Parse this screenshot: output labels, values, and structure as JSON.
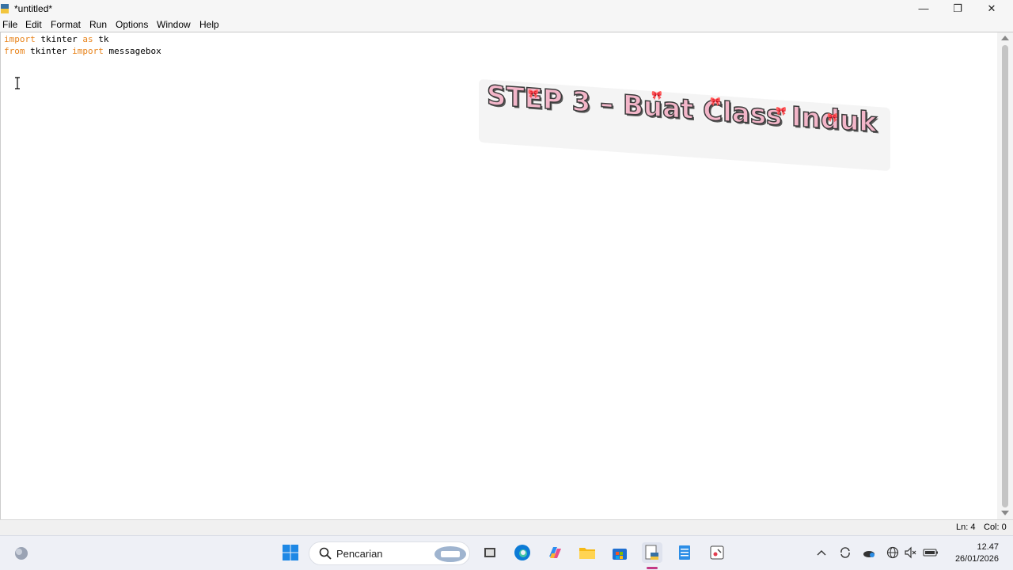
{
  "window": {
    "title": "*untitled*",
    "minimize_glyph": "—",
    "maximize_glyph": "❐",
    "close_glyph": "✕"
  },
  "menu": {
    "items": [
      "File",
      "Edit",
      "Format",
      "Run",
      "Options",
      "Window",
      "Help"
    ]
  },
  "editor": {
    "line1": {
      "kw1": "import",
      "rest1": " tkinter ",
      "kw2": "as",
      "rest2": " tk"
    },
    "line2": {
      "kw1": "from",
      "rest1": " tkinter ",
      "kw2": "import",
      "rest2": " messagebox"
    }
  },
  "overlay": {
    "caption": "STEP 3 – Buat Class Induk"
  },
  "status": {
    "line": "Ln: 4",
    "col": "Col: 0"
  },
  "taskbar": {
    "search_placeholder": "Pencarian",
    "time": "12.47",
    "date": "26/01/2026",
    "icons": [
      "weather-icon",
      "windows-start-icon",
      "search-icon",
      "task-view-icon",
      "edge-icon",
      "copilot-icon",
      "file-explorer-icon",
      "store-icon",
      "python-idle-icon",
      "notepad-icon",
      "snipping-tool-icon"
    ],
    "tray_icons": [
      "chevron-up-icon",
      "sync-icon",
      "onedrive-icon",
      "language-icon",
      "volume-muted-icon",
      "battery-icon"
    ]
  },
  "colors": {
    "keyword": "#e8841c",
    "sticker_pink": "#f3b6c9",
    "accent": "#c43a86"
  }
}
